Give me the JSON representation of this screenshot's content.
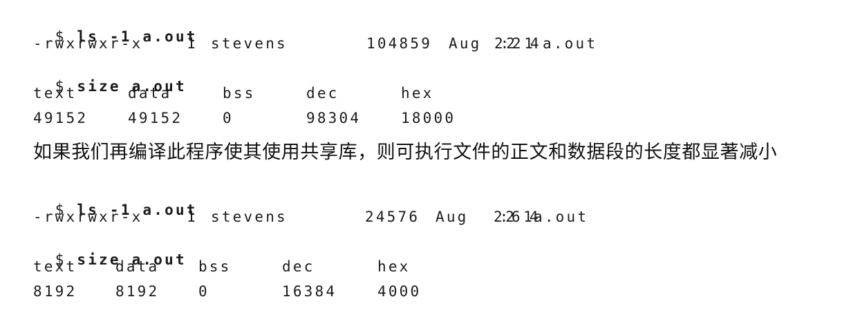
{
  "block1": {
    "cmd1": {
      "prompt": "$",
      "command": "ls -1 a.out"
    },
    "listing": {
      "perms": "-rwxrwxr-x",
      "links": "1",
      "owner": "stevens",
      "size": "104859",
      "month": "Aug",
      "time": "2:22 14",
      "name": "a.out"
    },
    "cmd2": {
      "prompt": "$",
      "command": "size a.out"
    },
    "headers": [
      "text",
      "data",
      "bss",
      "dec",
      "hex"
    ],
    "values": [
      "49152",
      "49152",
      "0",
      "98304",
      "18000"
    ]
  },
  "prose": "如果我们再编译此程序使其使用共享库，则可执行文件的正文和数据段的长度都显著减小",
  "block2": {
    "cmd1": {
      "prompt": "$",
      "command": "ls -1 a.out"
    },
    "listing": {
      "perms": "-rwxrwxr-x",
      "links": "1",
      "owner": "stevens",
      "size": "24576",
      "month": "Aug",
      "time": "2:26 14",
      "name": "a.out"
    },
    "cmd2": {
      "prompt": "$",
      "command": "size a.out"
    },
    "headers": [
      "text",
      "data",
      "bss",
      "dec",
      "hex"
    ],
    "values": [
      "8192",
      "8192",
      "0",
      "16384",
      "4000"
    ]
  }
}
